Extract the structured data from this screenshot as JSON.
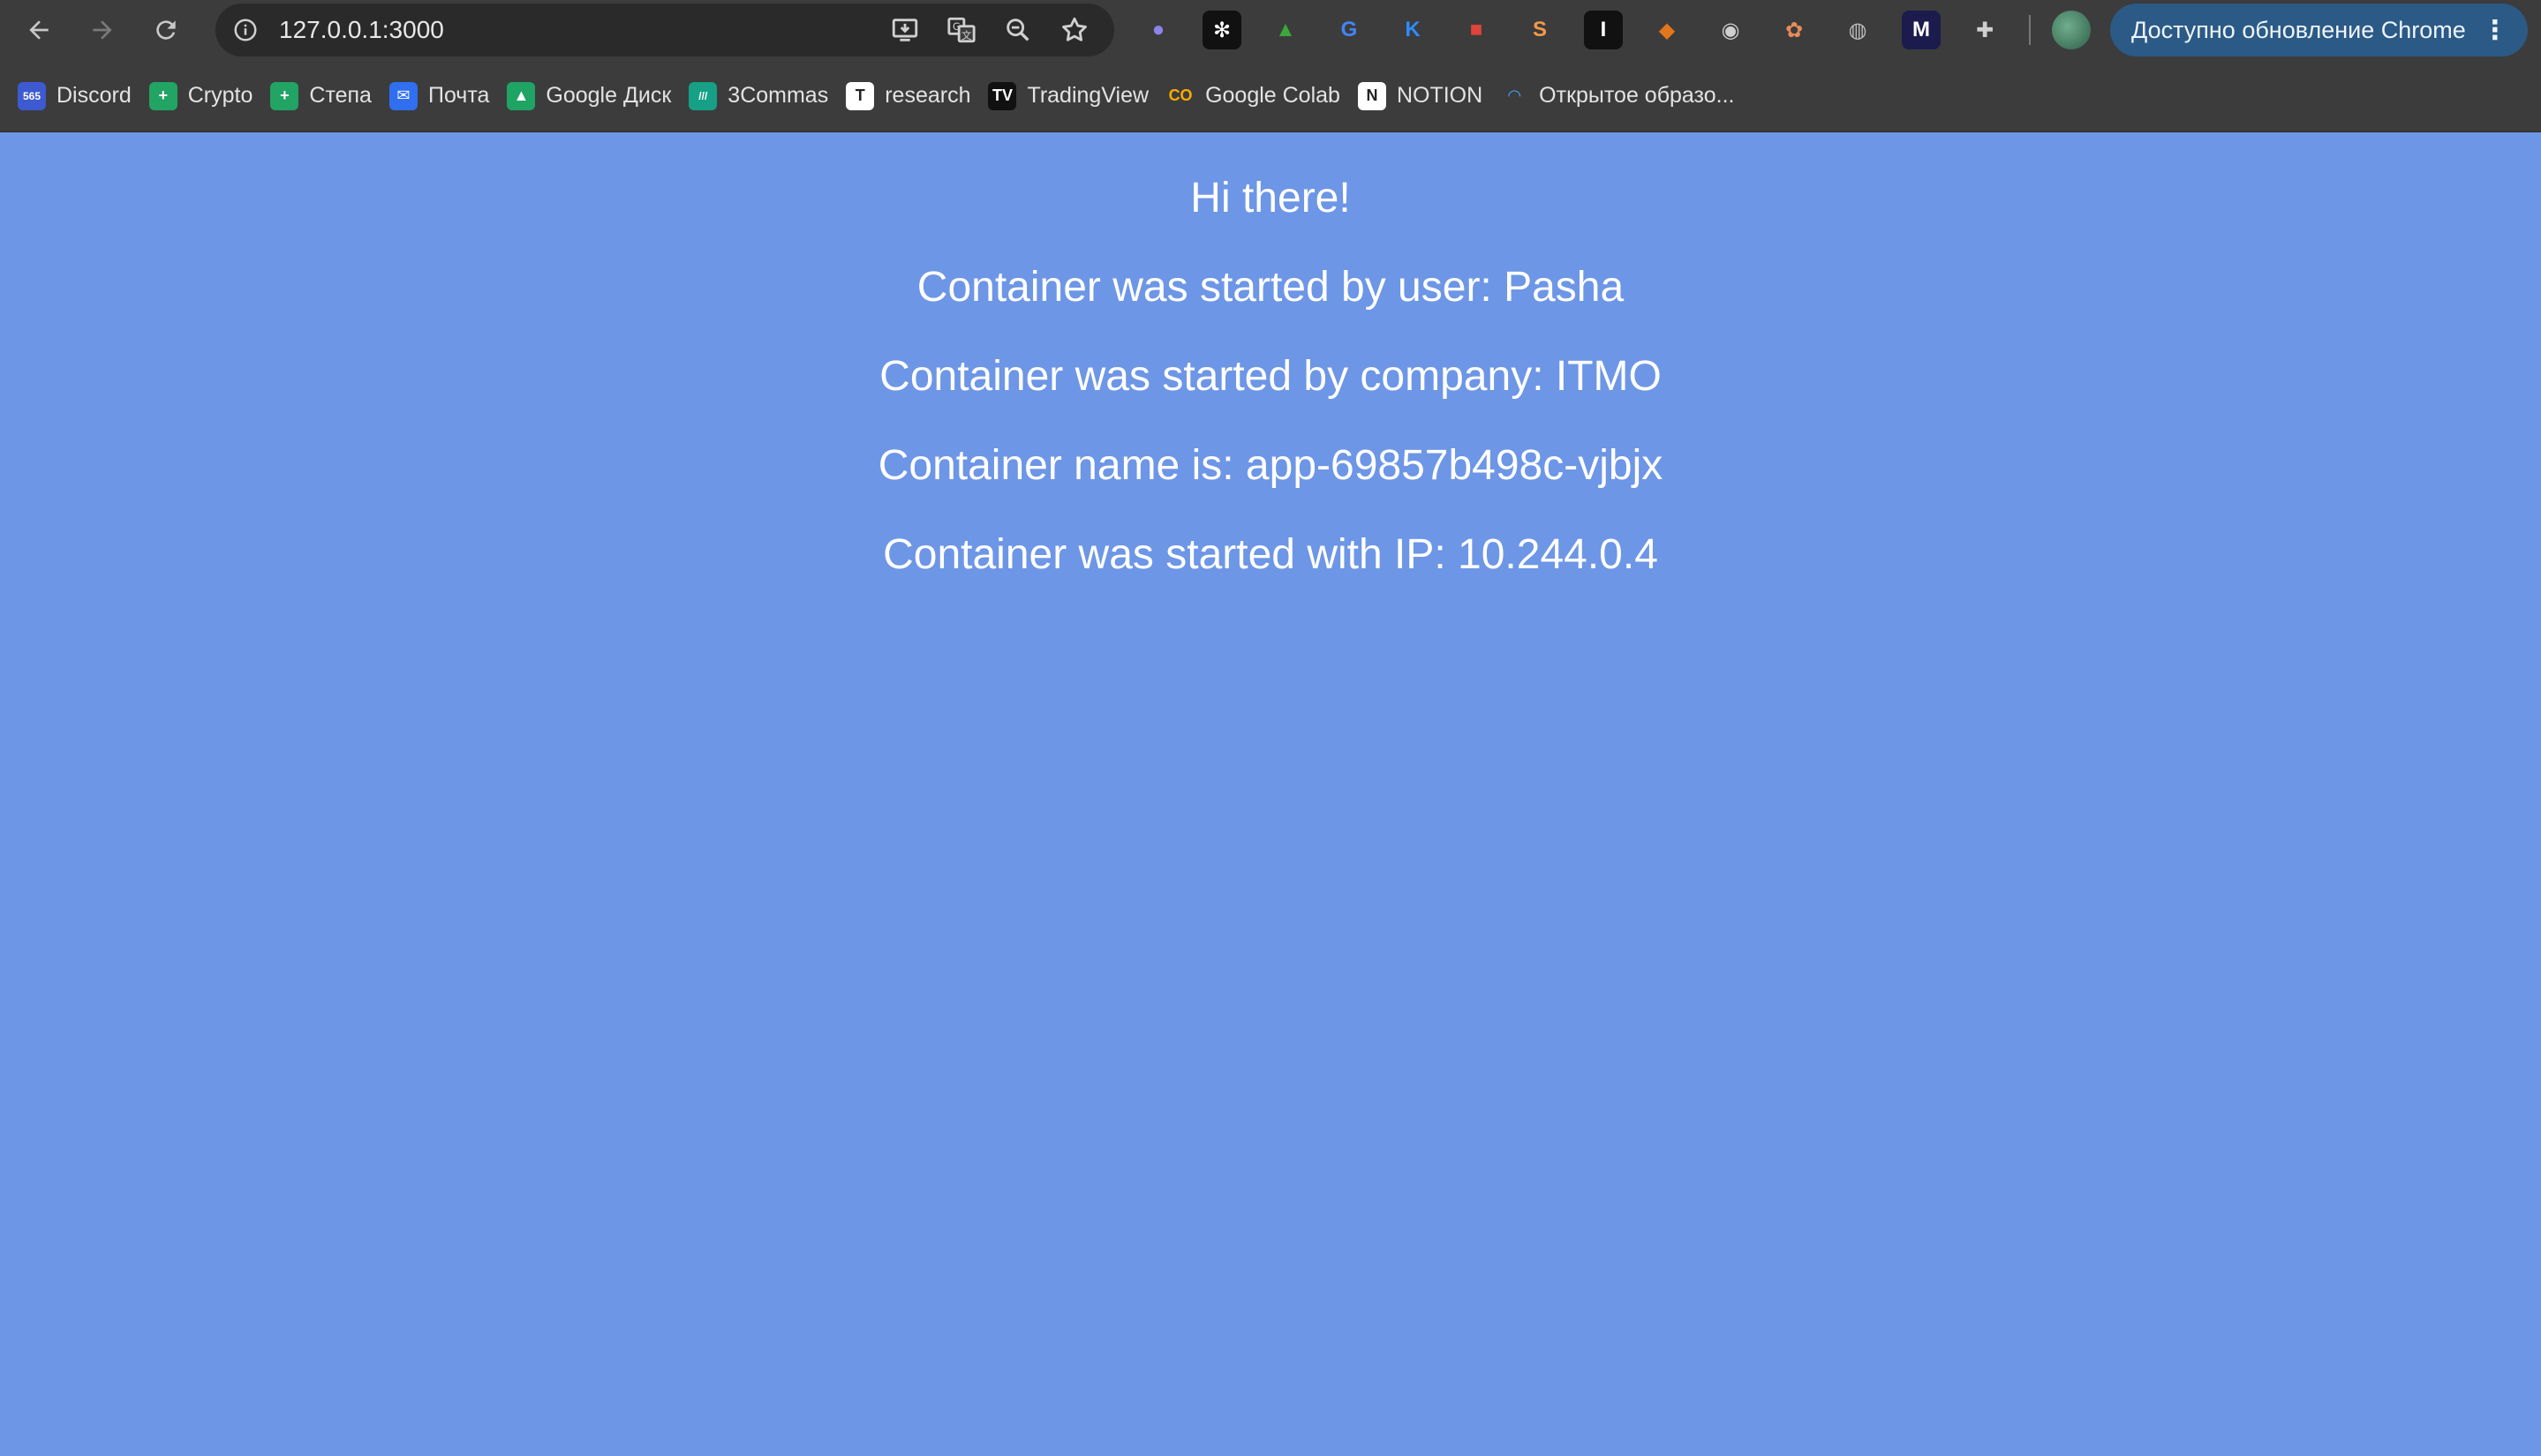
{
  "browser": {
    "url": "127.0.0.1:3000",
    "update_button": "Доступно обновление Chrome",
    "nav_icons": [
      "back-icon",
      "forward-icon",
      "reload-icon"
    ],
    "omnibox_icons": [
      "install-app-icon",
      "translate-icon",
      "zoom-icon",
      "bookmark-star-icon"
    ],
    "extensions": [
      {
        "name": "ghost-extension-icon",
        "color": "#8c84ea"
      },
      {
        "name": "snowflake-extension-icon",
        "color": "#111111"
      },
      {
        "name": "chart-extension-icon",
        "color": "#3aa83a"
      },
      {
        "name": "google-translate-extension-icon",
        "color": "#4285f4"
      },
      {
        "name": "k-extension-icon",
        "color": "#2d8cff"
      },
      {
        "name": "lock-extension-icon",
        "color": "#e0443b"
      },
      {
        "name": "s-extension-icon",
        "color": "#f2994a"
      },
      {
        "name": "i-extension-icon",
        "color": "#111111"
      },
      {
        "name": "metamask-extension-icon",
        "color": "#e2761b"
      },
      {
        "name": "owl-extension-icon",
        "color": "#cfcfcf"
      },
      {
        "name": "film-extension-icon",
        "color": "#e98b5a"
      },
      {
        "name": "globe-extension-icon",
        "color": "#bdbdbd"
      },
      {
        "name": "me-extension-icon",
        "color": "#1b1b4d"
      },
      {
        "name": "puzzle-extensions-icon",
        "color": "#d0d0d0"
      }
    ]
  },
  "bookmarks": [
    {
      "label": "Discord",
      "icon": "discord-icon",
      "color": "#3d5ad1"
    },
    {
      "label": "Crypto",
      "icon": "sheets-icon",
      "color": "#21a464"
    },
    {
      "label": "Степа",
      "icon": "sheets-icon",
      "color": "#21a464"
    },
    {
      "label": "Почта",
      "icon": "mail-icon",
      "color": "#2f6ff0"
    },
    {
      "label": "Google Диск",
      "icon": "drive-icon",
      "color": "#1fa463"
    },
    {
      "label": "3Commas",
      "icon": "3commas-icon",
      "color": "#16a085"
    },
    {
      "label": "research",
      "icon": "research-icon",
      "color": "#ffffff"
    },
    {
      "label": "TradingView",
      "icon": "tradingview-icon",
      "color": "#111111"
    },
    {
      "label": "Google Colab",
      "icon": "colab-icon",
      "color": "#f9ab00"
    },
    {
      "label": "NOTION",
      "icon": "notion-icon",
      "color": "#ffffff"
    },
    {
      "label": "Открытое образо...",
      "icon": "loading-icon",
      "color": "#4aa3ff"
    }
  ],
  "page": {
    "background": "#6d96e6",
    "lines": [
      "Hi there!",
      "Container was started by user: Pasha",
      "Container was started by company: ITMO",
      "Container name is: app-69857b498c-vjbjx",
      "Container was started with IP: 10.244.0.4"
    ]
  }
}
